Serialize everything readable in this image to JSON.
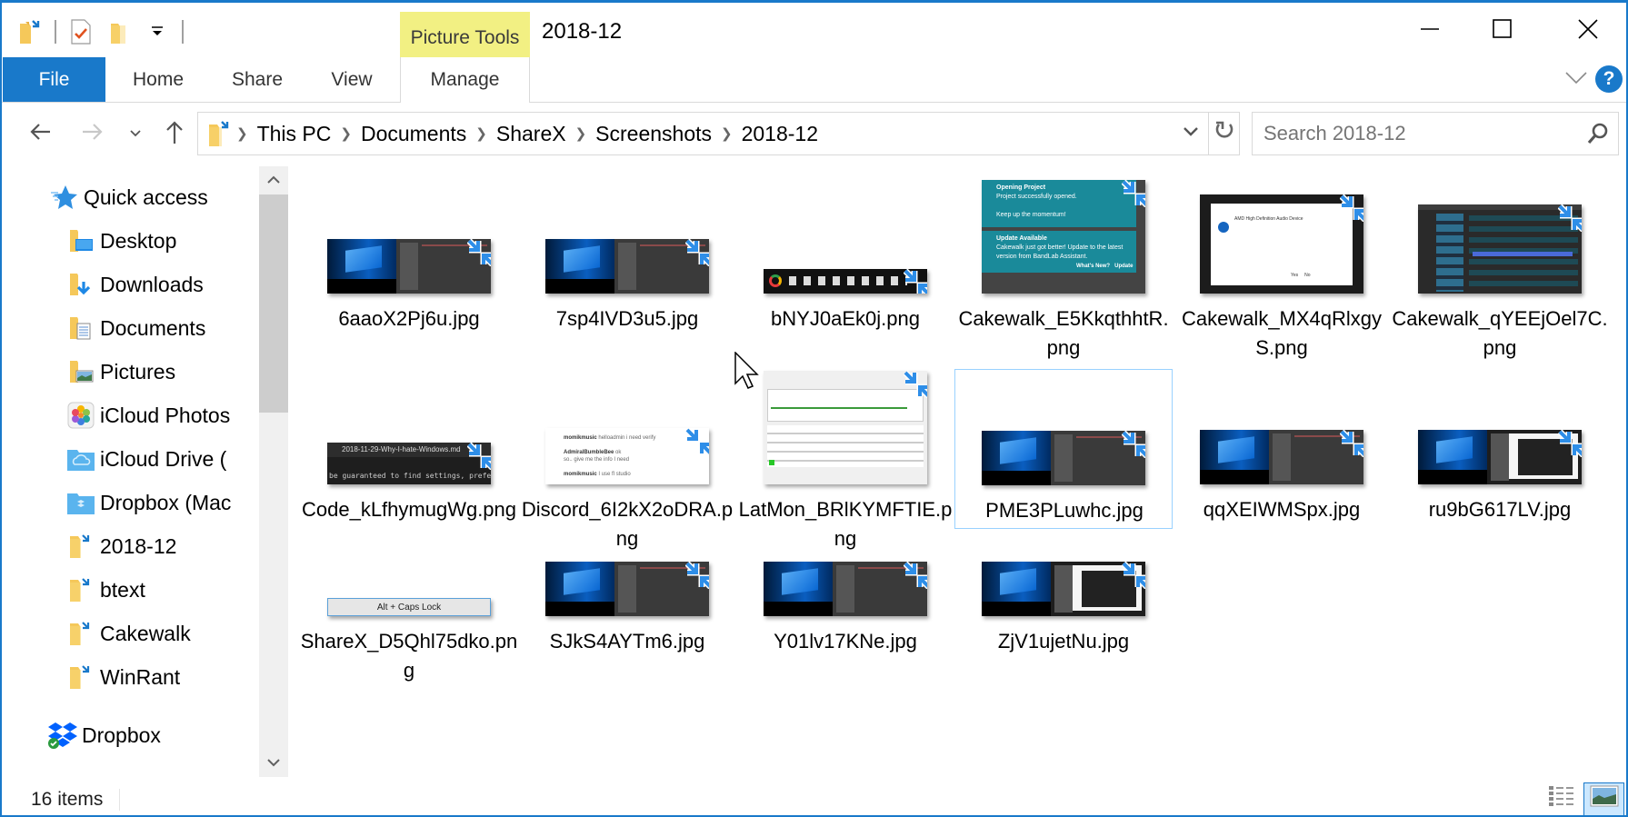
{
  "window": {
    "title": "2018-12",
    "contextual_tab_group": "Picture Tools",
    "controls": {
      "minimize": "minimize-icon",
      "maximize": "maximize-icon",
      "close": "close-icon"
    }
  },
  "quick_access_toolbar": {
    "items": [
      "properties-icon",
      "new-folder-icon",
      "customize-dropdown-icon"
    ]
  },
  "ribbon": {
    "tabs": [
      {
        "label": "File",
        "active": true
      },
      {
        "label": "Home"
      },
      {
        "label": "Share"
      },
      {
        "label": "View"
      },
      {
        "label": "Manage",
        "contextual": true
      }
    ],
    "help": "?"
  },
  "navigation": {
    "back": "back-arrow-icon",
    "forward": "forward-arrow-icon",
    "recent": "recent-locations-icon",
    "up": "up-arrow-icon",
    "breadcrumb": [
      "This PC",
      "Documents",
      "ShareX",
      "Screenshots",
      "2018-12"
    ],
    "search_placeholder": "Search 2018-12"
  },
  "sidebar": {
    "quick_access_label": "Quick access",
    "items": [
      {
        "label": "Desktop",
        "icon": "desktop-folder-icon",
        "pinned": true
      },
      {
        "label": "Downloads",
        "icon": "downloads-folder-icon",
        "pinned": true
      },
      {
        "label": "Documents",
        "icon": "documents-folder-icon",
        "pinned": true
      },
      {
        "label": "Pictures",
        "icon": "pictures-folder-icon",
        "pinned": true
      },
      {
        "label": "iCloud Photos",
        "icon": "icloud-photos-icon",
        "pinned": true
      },
      {
        "label": "iCloud Drive (",
        "icon": "icloud-drive-icon",
        "pinned": true
      },
      {
        "label": "Dropbox (Mac",
        "icon": "dropbox-folder-icon",
        "pinned": true
      },
      {
        "label": "2018-12",
        "icon": "folder-icon",
        "pinned": false
      },
      {
        "label": "btext",
        "icon": "folder-icon",
        "pinned": false
      },
      {
        "label": "Cakewalk",
        "icon": "folder-icon",
        "pinned": false
      },
      {
        "label": "WinRant",
        "icon": "folder-icon",
        "pinned": false
      }
    ],
    "dropbox_label": "Dropbox"
  },
  "files": [
    {
      "name": "6aaoX2Pj6u.jpg",
      "thumb": "desktop-daw"
    },
    {
      "name": "7sp4IVD3u5.jpg",
      "thumb": "desktop-daw"
    },
    {
      "name": "bNYJ0aEk0j.png",
      "thumb": "tray"
    },
    {
      "name": "Cakewalk_E5KkqthhtR.png",
      "thumb": "cakewalk-notify",
      "thumb_text": {
        "t1": "Opening Project",
        "t2": "Project successfully opened.",
        "t3": "Keep up the momentum!",
        "t4": "Update Available",
        "t5": "Cakewalk just got better! Update to the latest version from BandLab Assistant.",
        "b1": "What's New?",
        "b2": "Update"
      }
    },
    {
      "name": "Cakewalk_MX4qRlxgyS.png",
      "thumb": "dialog",
      "thumb_text": {
        "t1": "AMD High Definition Audio Device",
        "b1": "Yes",
        "b2": "No"
      }
    },
    {
      "name": "Cakewalk_qYEEjOel7C.png",
      "thumb": "daw"
    },
    {
      "name": "Code_kLfhymugWg.png",
      "thumb": "code",
      "thumb_text": {
        "t1": "2018-11-29-Why-I-hate-Windows.md",
        "t2": "be guaranteed to find settings, prefere"
      }
    },
    {
      "name": "Discord_6I2kX2oDRA.png",
      "thumb": "discord",
      "thumb_text": {
        "t1": "momikmusic",
        "t2": "helloadmin i need verify",
        "t3": "AdmiralBumbleBee",
        "t4": "ok",
        "t5": "so.. give me the info I need",
        "t6": "I use fl studio"
      }
    },
    {
      "name": "LatMon_BRlKYMFTIE.png",
      "thumb": "latmon"
    },
    {
      "name": "PME3PLuwhc.jpg",
      "thumb": "desktop-daw",
      "selected": true
    },
    {
      "name": "qqXEIWMSpx.jpg",
      "thumb": "desktop-daw"
    },
    {
      "name": "ru9bG617LV.jpg",
      "thumb": "desktop-editor"
    },
    {
      "name": "ShareX_D5Qhl75dko.png",
      "thumb": "key",
      "thumb_text": {
        "t1": "Alt + Caps Lock"
      }
    },
    {
      "name": "SJkS4AYTm6.jpg",
      "thumb": "desktop-daw"
    },
    {
      "name": "Y01lv17KNe.jpg",
      "thumb": "desktop-daw"
    },
    {
      "name": "ZjV1ujetNu.jpg",
      "thumb": "desktop-editor"
    }
  ],
  "status": {
    "item_count": "16 items",
    "views": [
      "details-view-icon",
      "large-icons-view-icon"
    ],
    "active_view": "large-icons-view-icon"
  },
  "colors": {
    "accent": "#1979ca",
    "contextual_tab": "#f2f083",
    "selection_border": "#99d1ff",
    "folder": "#f5c85a"
  }
}
